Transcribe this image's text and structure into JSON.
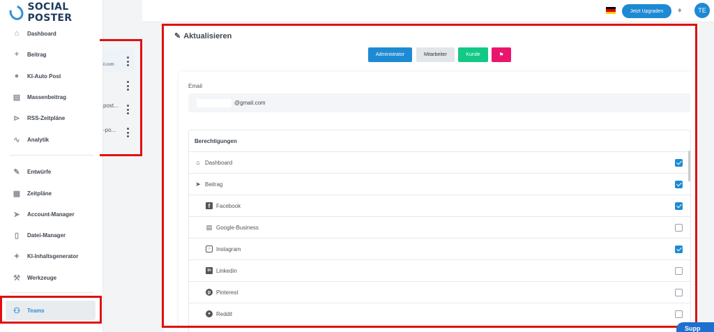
{
  "brand": {
    "logo_text": "SOCIAL POSTER"
  },
  "sidebar": {
    "items": [
      {
        "label": "Dashboard",
        "icon": "home-icon"
      },
      {
        "label": "Beitrag",
        "icon": "plus-icon"
      },
      {
        "label": "KI-Auto Post",
        "icon": "brain-icon"
      },
      {
        "label": "Massenbeitrag",
        "icon": "bulk-icon"
      },
      {
        "label": "RSS-Zeitpläne",
        "icon": "rss-icon"
      },
      {
        "label": "Analytik",
        "icon": "chart-icon"
      },
      {
        "label": "Entwürfe",
        "icon": "pencil-icon"
      },
      {
        "label": "Zeitpläne",
        "icon": "calendar-icon"
      },
      {
        "label": "Account-Manager",
        "icon": "send-icon"
      },
      {
        "label": "Datei-Manager",
        "icon": "folder-icon"
      },
      {
        "label": "KI-Inhaltsgenerator",
        "icon": "magic-wand-icon"
      },
      {
        "label": "Werkzeuge",
        "icon": "wrench-icon"
      },
      {
        "label": "Teams",
        "icon": "users-icon"
      }
    ]
  },
  "team_list": {
    "items": [
      {
        "text": "il.com"
      },
      {
        "text": ""
      },
      {
        "text": "post..."
      },
      {
        "text": "-po..."
      }
    ]
  },
  "topbar": {
    "upgrade_label": "Jetzt Upgraden",
    "avatar_initials": "TE"
  },
  "main": {
    "title": "Aktualisieren",
    "roles": [
      {
        "label": "Administrator",
        "color": "#1e8ad3"
      },
      {
        "label": "Mitarbeiter",
        "color": "#e2e5ea"
      },
      {
        "label": "Kunde",
        "color": "#12c985"
      },
      {
        "label": "",
        "color": "#e8166c"
      }
    ],
    "email_label": "Email",
    "email_value": "@gmail.com",
    "permissions_title": "Berechtigungen",
    "permissions": [
      {
        "label": "Dashboard",
        "icon": "home-icon",
        "checked": true,
        "indent": false
      },
      {
        "label": "Beitrag",
        "icon": "send-icon",
        "checked": true,
        "indent": false
      },
      {
        "label": "Facebook",
        "icon": "facebook-icon",
        "checked": true,
        "indent": true
      },
      {
        "label": "Google-Business",
        "icon": "store-icon",
        "checked": false,
        "indent": true
      },
      {
        "label": "Instagram",
        "icon": "instagram-icon",
        "checked": true,
        "indent": true
      },
      {
        "label": "Linkedin",
        "icon": "linkedin-icon",
        "checked": false,
        "indent": true
      },
      {
        "label": "Pinterest",
        "icon": "pinterest-icon",
        "checked": false,
        "indent": true
      },
      {
        "label": "Reddit",
        "icon": "reddit-icon",
        "checked": false,
        "indent": true
      }
    ]
  },
  "support": {
    "label": "Supp"
  }
}
